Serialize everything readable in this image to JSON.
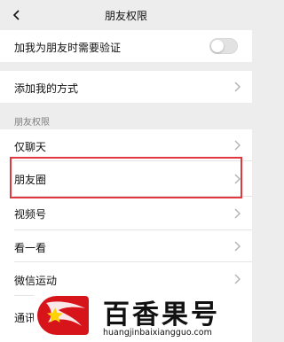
{
  "header": {
    "title": "朋友权限",
    "back_icon": "chevron-left-icon"
  },
  "settings": {
    "verify_label": "加我为朋友时需要验证",
    "verify_enabled": false,
    "add_methods_label": "添加我的方式"
  },
  "friend_permissions": {
    "section_title": "朋友权限",
    "items": [
      {
        "label": "仅聊天"
      },
      {
        "label": "朋友圈"
      },
      {
        "label": "视频号"
      },
      {
        "label": "看一看"
      },
      {
        "label": "微信运动"
      },
      {
        "label": "通讯"
      }
    ]
  },
  "watermark": {
    "title": "百香果号",
    "url": "huangjinbaixiangguo.com",
    "logo_color": "#d8141b"
  },
  "colors": {
    "highlight": "#e0383e",
    "background": "#ededed"
  }
}
